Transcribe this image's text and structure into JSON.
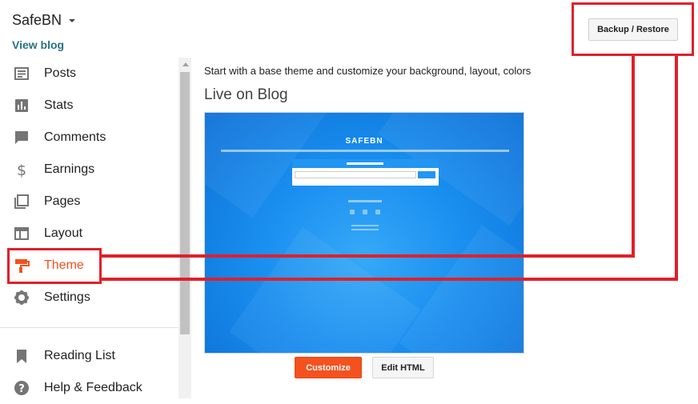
{
  "header": {
    "blog_title": "SafeBN",
    "view_blog": "View blog"
  },
  "sidebar": {
    "items": [
      {
        "label": "Posts",
        "icon": "posts-icon"
      },
      {
        "label": "Stats",
        "icon": "stats-icon"
      },
      {
        "label": "Comments",
        "icon": "comments-icon"
      },
      {
        "label": "Earnings",
        "icon": "earnings-icon"
      },
      {
        "label": "Pages",
        "icon": "pages-icon"
      },
      {
        "label": "Layout",
        "icon": "layout-icon"
      },
      {
        "label": "Theme",
        "icon": "theme-icon",
        "active": true
      },
      {
        "label": "Settings",
        "icon": "settings-icon"
      }
    ],
    "secondary": [
      {
        "label": "Reading List",
        "icon": "bookmark-icon"
      },
      {
        "label": "Help & Feedback",
        "icon": "help-icon"
      }
    ]
  },
  "main": {
    "intro": "Start with a base theme and customize your background, layout, colors",
    "live_heading": "Live on Blog",
    "preview": {
      "site_title": "SAFEBN"
    },
    "customize_label": "Customize",
    "edit_html_label": "Edit HTML",
    "backup_restore_label": "Backup / Restore"
  },
  "colors": {
    "accent": "#f4511e",
    "link": "#26737f",
    "annotation": "#e0202a",
    "icon": "#757575"
  }
}
